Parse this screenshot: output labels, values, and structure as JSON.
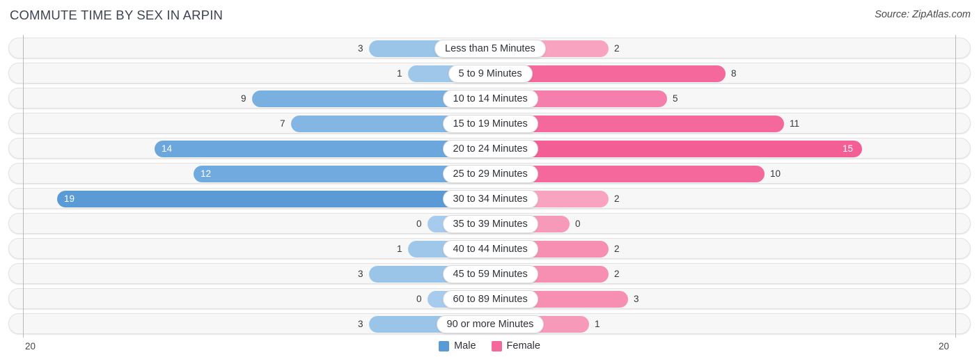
{
  "header": {
    "title": "COMMUTE TIME BY SEX IN ARPIN",
    "source": "Source: ZipAtlas.com"
  },
  "axis": {
    "left_tick": "20",
    "right_tick": "20"
  },
  "legend": {
    "items": [
      {
        "label": "Male",
        "color": "#5b9bd5"
      },
      {
        "label": "Female",
        "color": "#f4689b"
      }
    ]
  },
  "chart_data": {
    "type": "bar",
    "orientation": "horizontal-diverging",
    "title": "COMMUTE TIME BY SEX IN ARPIN",
    "subtitle": "Source: ZipAtlas.com",
    "xlabel": "",
    "ylabel": "",
    "xlim": [
      -20,
      20
    ],
    "axis_ticks": [
      "20",
      "20"
    ],
    "grid": false,
    "legend_position": "bottom-center",
    "categories": [
      "Less than 5 Minutes",
      "5 to 9 Minutes",
      "10 to 14 Minutes",
      "15 to 19 Minutes",
      "20 to 24 Minutes",
      "25 to 29 Minutes",
      "30 to 34 Minutes",
      "35 to 39 Minutes",
      "40 to 44 Minutes",
      "45 to 59 Minutes",
      "60 to 89 Minutes",
      "90 or more Minutes"
    ],
    "series": [
      {
        "name": "Male",
        "color": "#5b9bd5",
        "values": [
          3,
          1,
          9,
          7,
          14,
          12,
          19,
          0,
          1,
          3,
          0,
          3
        ]
      },
      {
        "name": "Female",
        "color": "#f4689b",
        "values": [
          2,
          8,
          5,
          11,
          15,
          10,
          2,
          0,
          2,
          2,
          3,
          1
        ]
      }
    ]
  },
  "rows": [
    {
      "label": "Less than 5 Minutes",
      "male": "3",
      "female": "2",
      "male_inside": false,
      "female_inside": false,
      "male_color": "#9ac4e8",
      "female_color": "#f8a3c0"
    },
    {
      "label": "5 to 9 Minutes",
      "male": "1",
      "female": "8",
      "male_inside": false,
      "female_inside": false,
      "male_color": "#9ec7ea",
      "female_color": "#f4689b"
    },
    {
      "label": "10 to 14 Minutes",
      "male": "9",
      "female": "5",
      "male_inside": false,
      "female_inside": false,
      "male_color": "#79b0e0",
      "female_color": "#f67ead"
    },
    {
      "label": "15 to 19 Minutes",
      "male": "7",
      "female": "11",
      "male_inside": false,
      "female_inside": false,
      "male_color": "#83b6e3",
      "female_color": "#f4689b"
    },
    {
      "label": "20 to 24 Minutes",
      "male": "14",
      "female": "15",
      "male_inside": true,
      "female_inside": true,
      "male_color": "#6ba6dc",
      "female_color": "#f35e94"
    },
    {
      "label": "25 to 29 Minutes",
      "male": "12",
      "female": "10",
      "male_inside": true,
      "female_inside": false,
      "male_color": "#71aade",
      "female_color": "#f4689b"
    },
    {
      "label": "30 to 34 Minutes",
      "male": "19",
      "female": "2",
      "male_inside": true,
      "female_inside": false,
      "male_color": "#5b9bd5",
      "female_color": "#f8a3c0"
    },
    {
      "label": "35 to 39 Minutes",
      "male": "0",
      "female": "0",
      "male_inside": false,
      "female_inside": false,
      "male_color": "#a6cbec",
      "female_color": "#f79ab9"
    },
    {
      "label": "40 to 44 Minutes",
      "male": "1",
      "female": "2",
      "male_inside": false,
      "female_inside": false,
      "male_color": "#9ec7ea",
      "female_color": "#f68fb2"
    },
    {
      "label": "45 to 59 Minutes",
      "male": "3",
      "female": "2",
      "male_inside": false,
      "female_inside": false,
      "male_color": "#9ac4e8",
      "female_color": "#f68fb2"
    },
    {
      "label": "60 to 89 Minutes",
      "male": "0",
      "female": "3",
      "male_inside": false,
      "female_inside": false,
      "male_color": "#a6cbec",
      "female_color": "#f68fb2"
    },
    {
      "label": "90 or more Minutes",
      "male": "3",
      "female": "1",
      "male_inside": false,
      "female_inside": false,
      "male_color": "#9ac4e8",
      "female_color": "#f79ab9"
    }
  ]
}
